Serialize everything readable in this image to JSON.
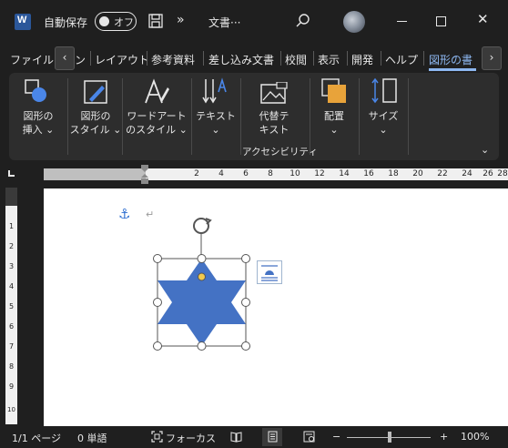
{
  "app": {
    "autosave_label": "自動保存",
    "toggle_state": "オフ",
    "doc_title": "文書···",
    "more_label": "»"
  },
  "tabs": {
    "items": [
      "ファイル",
      "ン",
      "レイアウト",
      "参考資料",
      "差し込み文書",
      "校閲",
      "表示",
      "開発",
      "ヘルプ",
      "図形の書"
    ],
    "active": "図形の書",
    "scroll_left": "‹",
    "scroll_right": "›"
  },
  "ribbon": {
    "insert_shape": [
      "図形の",
      "挿入 ⌄"
    ],
    "shape_styles": [
      "図形の",
      "スタイル ⌄"
    ],
    "wordart": [
      "ワードアート",
      "のスタイル ⌄"
    ],
    "text": [
      "テキスト",
      "⌄"
    ],
    "alt_text": [
      "代替テ",
      "キスト"
    ],
    "accessibility_group": "アクセシビリティ",
    "arrange": [
      "配置",
      "⌄"
    ],
    "size": [
      "サイズ",
      "⌄"
    ],
    "collapse": "⌄"
  },
  "ruler": {
    "h_numbers": [
      "2",
      "4",
      "6",
      "8",
      "10",
      "12",
      "14",
      "16",
      "18",
      "20",
      "22",
      "24",
      "26",
      "28"
    ],
    "v_numbers": [
      "1",
      "2",
      "3",
      "4",
      "5",
      "6",
      "7",
      "8",
      "9",
      "10"
    ]
  },
  "document": {
    "paragraph_mark": "↵",
    "anchor": "⚓"
  },
  "statusbar": {
    "page": "1/1 ページ",
    "words": "0 単語",
    "focus": "フォーカス",
    "zoom_minus": "−",
    "zoom_plus": "+",
    "zoom_level": "100%",
    "zoom_fraction": 0.5
  },
  "colors": {
    "shape_fill": "#4472c4",
    "accent": "#8db7f0",
    "word_blue": "#2b579a",
    "arrange_orange": "#e8a33a"
  }
}
